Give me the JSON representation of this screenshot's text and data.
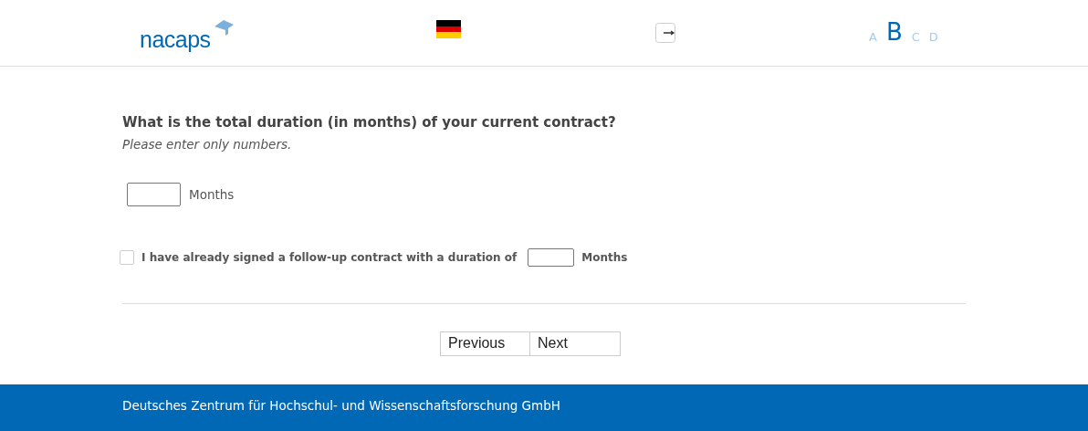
{
  "header": {
    "logo": "nacaps",
    "font_sizes": [
      {
        "label": "A",
        "selected": false
      },
      {
        "label": "B",
        "selected": true
      },
      {
        "label": "C",
        "selected": false
      },
      {
        "label": "D",
        "selected": false
      }
    ]
  },
  "question": {
    "title": "What is the total duration (in months) of your current contract?",
    "hint": "Please enter only numbers.",
    "unit": "Months"
  },
  "follow_up": {
    "checked": false,
    "label": "I have already signed a follow-up contract with a duration of",
    "unit": "Months"
  },
  "buttons": [
    "Previous",
    "Next"
  ],
  "footer": "Deutsches Zentrum für Hochschul- und Wissenschaftsforschung GmbH"
}
